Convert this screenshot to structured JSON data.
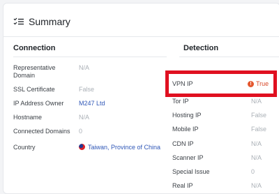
{
  "summary": {
    "title": "Summary"
  },
  "connection": {
    "header": "Connection",
    "rows": [
      {
        "label": "Representative Domain",
        "value": "N/A"
      },
      {
        "label": "SSL Certificate",
        "value": "False"
      },
      {
        "label": "IP Address Owner",
        "value": "M247 Ltd"
      },
      {
        "label": "Hostname",
        "value": "N/A"
      },
      {
        "label": "Connected Domains",
        "value": "0"
      },
      {
        "label": "Country",
        "value": "Taiwan, Province of China"
      }
    ]
  },
  "detection": {
    "header": "Detection",
    "rows": [
      {
        "label": "VPN IP",
        "value": "True"
      },
      {
        "label": "Tor IP",
        "value": "N/A"
      },
      {
        "label": "Hosting IP",
        "value": "False"
      },
      {
        "label": "Mobile IP",
        "value": "False"
      },
      {
        "label": "CDN IP",
        "value": "N/A"
      },
      {
        "label": "Scanner IP",
        "value": "N/A"
      },
      {
        "label": "Special Issue",
        "value": "0"
      },
      {
        "label": "Real IP",
        "value": "N/A"
      }
    ]
  },
  "colors": {
    "highlight": "#e01020",
    "alert": "#e4572e",
    "link": "#2f57b7"
  },
  "icons": {
    "summary": "list-check-icon",
    "alert": "alert-circle-icon",
    "flag": "taiwan-flag-icon"
  }
}
